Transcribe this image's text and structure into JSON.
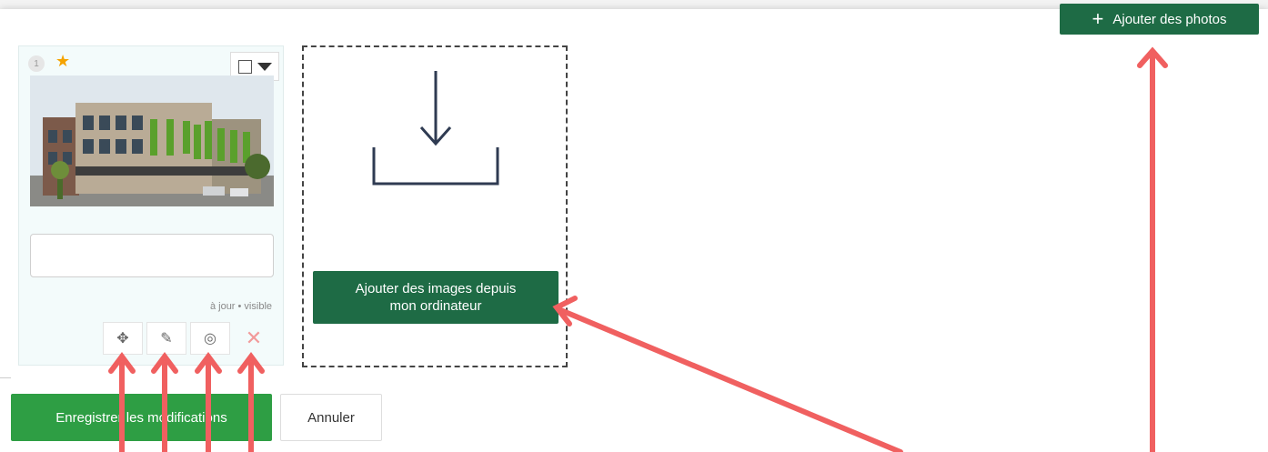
{
  "header": {
    "add_photos_label": "Ajouter des photos",
    "add_icon": "plus-icon"
  },
  "photo_card": {
    "order_number": "1",
    "featured_icon": "star-icon",
    "caption_value": "",
    "status_text": "à jour • visible",
    "actions": [
      {
        "name": "move",
        "icon": "move-icon",
        "glyph": "✥"
      },
      {
        "name": "edit",
        "icon": "edit-icon",
        "glyph": "✎"
      },
      {
        "name": "visibility",
        "icon": "eye-slash-icon",
        "glyph": "◎"
      },
      {
        "name": "delete",
        "icon": "close-icon",
        "glyph": "✕"
      }
    ]
  },
  "dropzone": {
    "icon": "download-icon",
    "upload_label": "Ajouter des images depuis\nmon ordinateur"
  },
  "footer": {
    "save_label": "Enregistrer les modifications",
    "cancel_label": "Annuler"
  },
  "colors": {
    "primary_dark_green": "#1e6b45",
    "save_green": "#2e9e44",
    "annotation_red": "#f06060",
    "star": "#f5a300"
  }
}
